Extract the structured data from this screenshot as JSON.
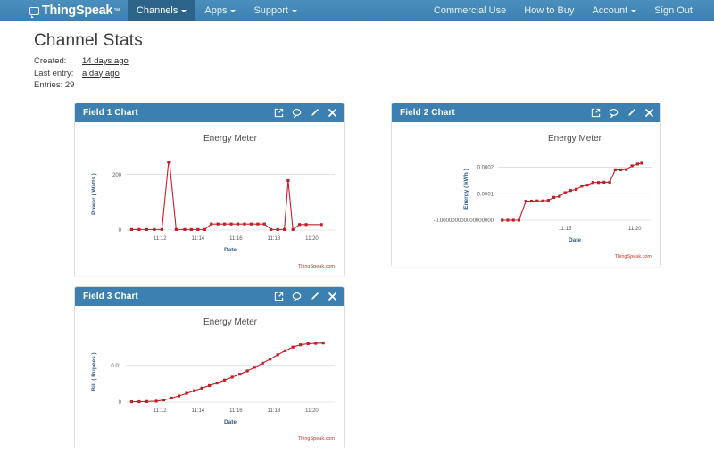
{
  "navbar": {
    "brand": "ThingSpeak",
    "brand_tm": "™",
    "brand_icon": "speech-bubble-icon",
    "left_items": [
      {
        "label": "Channels",
        "has_caret": true,
        "active": true
      },
      {
        "label": "Apps",
        "has_caret": true,
        "active": false
      },
      {
        "label": "Support",
        "has_caret": true,
        "active": false
      }
    ],
    "right_items": [
      {
        "label": "Commercial Use",
        "has_caret": false
      },
      {
        "label": "How to Buy",
        "has_caret": false
      },
      {
        "label": "Account",
        "has_caret": true
      },
      {
        "label": "Sign Out",
        "has_caret": false
      }
    ],
    "bg_color": "#3f85b5",
    "active_bg_color": "#2c6489"
  },
  "page": {
    "title": "Channel Stats",
    "stats": {
      "created_label": "Created:",
      "created_value": "14 days ago",
      "last_entry_label": "Last entry:",
      "last_entry_value": "a day ago",
      "entries_label": "Entries:",
      "entries_value": "29"
    }
  },
  "panel_tools": [
    {
      "name": "export-icon",
      "title": "export"
    },
    {
      "name": "comment-icon",
      "title": "comment"
    },
    {
      "name": "edit-pencil-icon",
      "title": "edit"
    },
    {
      "name": "close-icon",
      "title": "close"
    }
  ],
  "panels": [
    {
      "title": "Field 1 Chart"
    },
    {
      "title": "Field 2 Chart"
    },
    {
      "title": "Field 3 Chart"
    }
  ],
  "chart_data": [
    {
      "id": "field1",
      "type": "line",
      "title": "Energy Meter",
      "xlabel": "Date",
      "ylabel": "Power ( Watts )",
      "credit": "ThingSpeak.com",
      "yticks": [
        "0",
        "200"
      ],
      "ytick_values": [
        0,
        200
      ],
      "xticks": [
        "11:12",
        "11:14",
        "11:16",
        "11:18",
        "11:20"
      ],
      "xtick_values": [
        11.2,
        11.4,
        11.6,
        11.8,
        12.0
      ],
      "ylim": [
        0,
        260
      ],
      "xlim": [
        11.02,
        12.12
      ],
      "line_color": "#c0202a",
      "x": [
        11.05,
        11.09,
        11.13,
        11.17,
        11.21,
        11.245,
        11.25,
        11.285,
        11.33,
        11.365,
        11.4,
        11.435,
        11.47,
        11.505,
        11.54,
        11.575,
        11.61,
        11.645,
        11.68,
        11.715,
        11.75,
        11.785,
        11.82,
        11.855,
        11.875,
        11.9,
        11.935,
        11.97,
        12.05
      ],
      "values": [
        2,
        2,
        2,
        2,
        2,
        245,
        245,
        2,
        2,
        2,
        2,
        2,
        22,
        22,
        22,
        22,
        22,
        22,
        22,
        22,
        22,
        2,
        2,
        2,
        178,
        2,
        20,
        20,
        20
      ],
      "ylabel_color": "#2f5c82"
    },
    {
      "id": "field2",
      "type": "line",
      "title": "Energy Meter",
      "xlabel": "Date",
      "ylabel": "Energy ( kWh )",
      "credit": "ThingSpeak.com",
      "yticks": [
        "-0.000000000000000000",
        "0.0001",
        "0.0002"
      ],
      "ytick_values": [
        0,
        0.0001,
        0.0002
      ],
      "xticks": [
        "11:15",
        "11:20"
      ],
      "xtick_values": [
        11.5,
        12.0
      ],
      "ylim": [
        0,
        0.000235
      ],
      "xlim": [
        11.02,
        12.12
      ],
      "line_color": "#c0202a",
      "x": [
        11.05,
        11.09,
        11.13,
        11.17,
        11.22,
        11.26,
        11.3,
        11.34,
        11.38,
        11.42,
        11.46,
        11.5,
        11.54,
        11.58,
        11.62,
        11.66,
        11.7,
        11.74,
        11.78,
        11.82,
        11.86,
        11.9,
        11.94,
        11.98,
        12.02,
        12.05
      ],
      "values": [
        0,
        0,
        0,
        0,
        7.2e-05,
        7.2e-05,
        7.3e-05,
        7.3e-05,
        7.5e-05,
        8.6e-05,
        9e-05,
        0.000104,
        0.000112,
        0.000116,
        0.000128,
        0.000132,
        0.000142,
        0.000142,
        0.000143,
        0.000143,
        0.00019,
        0.00019,
        0.000191,
        0.000205,
        0.000212,
        0.000215
      ],
      "ylabel_color": "#2f5c82"
    },
    {
      "id": "field3",
      "type": "line",
      "title": "Energy Meter",
      "xlabel": "Date",
      "ylabel": "Bill ( Rupees )",
      "credit": "ThingSpeak.com",
      "yticks": [
        "0",
        "0.01"
      ],
      "ytick_values": [
        0,
        0.01
      ],
      "xticks": [
        "11:12",
        "11:14",
        "11:16",
        "11:18",
        "11:20"
      ],
      "xtick_values": [
        11.2,
        11.4,
        11.6,
        11.8,
        12.0
      ],
      "ylim": [
        0,
        0.0165
      ],
      "xlim": [
        11.02,
        12.12
      ],
      "line_color": "#c0202a",
      "x": [
        11.05,
        11.09,
        11.13,
        11.18,
        11.22,
        11.26,
        11.3,
        11.34,
        11.38,
        11.42,
        11.46,
        11.5,
        11.54,
        11.58,
        11.62,
        11.66,
        11.7,
        11.74,
        11.78,
        11.82,
        11.86,
        11.9,
        11.94,
        11.98,
        12.02,
        12.06
      ],
      "values": [
        0.0001,
        0.00012,
        0.00016,
        0.00025,
        0.0006,
        0.0011,
        0.0017,
        0.0024,
        0.0031,
        0.0038,
        0.0045,
        0.0052,
        0.006,
        0.0068,
        0.0076,
        0.0085,
        0.0095,
        0.0106,
        0.0117,
        0.0129,
        0.014,
        0.015,
        0.0156,
        0.0159,
        0.016,
        0.0161
      ],
      "ylabel_color": "#2f5c82"
    }
  ]
}
